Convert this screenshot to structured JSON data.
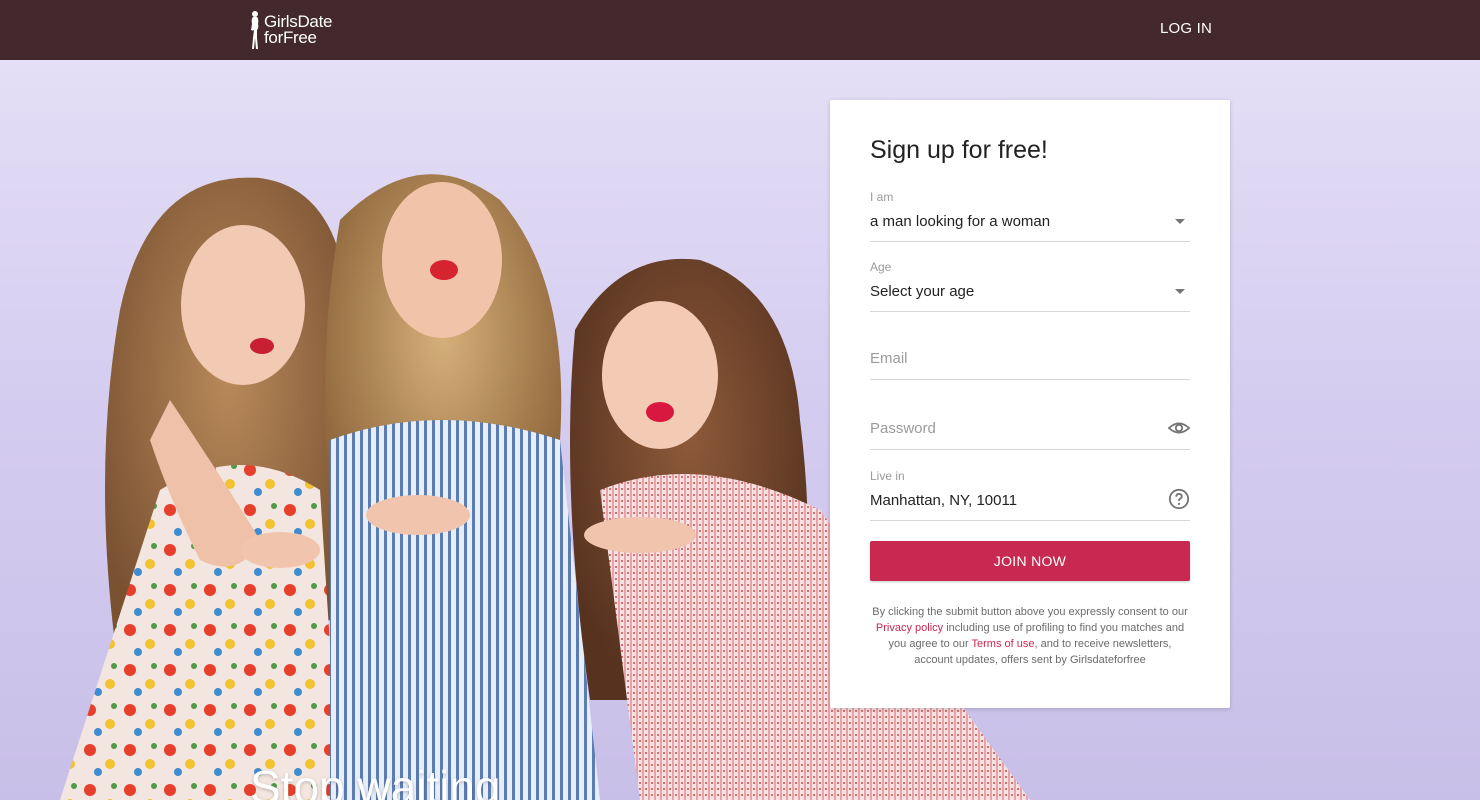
{
  "header": {
    "logo_line1": "GirlsDate",
    "logo_line2": "forFree",
    "login_label": "LOG IN",
    "background": "#43292d"
  },
  "hero": {
    "headline": "Stop waiting"
  },
  "signup": {
    "title": "Sign up for free!",
    "i_am": {
      "label": "I am",
      "value": "a man looking for a woman"
    },
    "age": {
      "label": "Age",
      "value": "Select your age"
    },
    "email": {
      "placeholder": "Email"
    },
    "password": {
      "placeholder": "Password"
    },
    "live_in": {
      "label": "Live in",
      "value": "Manhattan, NY, 10011"
    },
    "join_label": "JOIN NOW",
    "consent": {
      "part1": "By clicking the submit button above you expressly consent to our ",
      "privacy_link": "Privacy policy",
      "part2": " including use of profiling to find you matches and you agree to our ",
      "terms_link": "Terms of use",
      "part3": ", and to receive newsletters, account updates, offers sent by Girlsdateforfree"
    }
  },
  "colors": {
    "accent": "#c72950",
    "hero_background": "#d5cdf0"
  },
  "icons": {
    "logo": "woman-silhouette-icon",
    "dropdown": "caret-down-icon",
    "password_toggle": "eye-icon",
    "location_help": "help-circle-icon"
  }
}
